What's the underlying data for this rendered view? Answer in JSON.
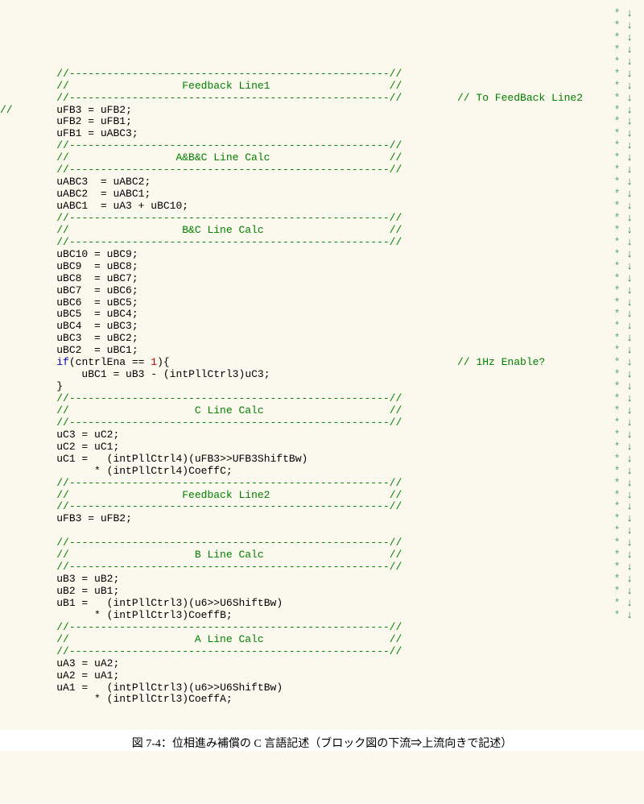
{
  "margin_marker": "* ↓",
  "keywords": {
    "if": "if"
  },
  "numbers": {
    "one": "1"
  },
  "vars": {
    "uFB3": "uFB3",
    "uFB2": "uFB2",
    "uFB1": "uFB1",
    "uABC3": "uABC3",
    "uABC2": "uABC2",
    "uABC1": "uABC1",
    "uA3": "uA3",
    "uA2": "uA2",
    "uA1": "uA1",
    "uB3": "uB3",
    "uB2": "uB2",
    "uB1": "uB1",
    "uC3": "uC3",
    "uC2": "uC2",
    "uC1": "uC1",
    "uBC10": "uBC10",
    "uBC9": "uBC9",
    "uBC8": "uBC8",
    "uBC7": "uBC7",
    "uBC6": "uBC6",
    "uBC5": "uBC5",
    "uBC4": "uBC4",
    "uBC3": "uBC3",
    "uBC2": "uBC2",
    "uBC1": "uBC1",
    "cntrlEna": "cntrlEna",
    "intPllCtrl3": "intPllCtrl3",
    "intPllCtrl4": "intPllCtrl4",
    "UFB3ShiftBw": "UFB3ShiftBw",
    "U6ShiftBw": "U6ShiftBw",
    "CoeffC": "CoeffC",
    "CoeffB": "CoeffB",
    "CoeffA": "CoeffA",
    "u6": "u6"
  },
  "side_comments": {
    "left_dblslash": "//",
    "to_fb_line2": "// To FeedBack Line2",
    "one_hz": "// 1Hz Enable?"
  },
  "sections": {
    "feedback1": "Feedback Line1",
    "abc": "A&B&C Line Calc",
    "bc": "B&C Line Calc",
    "c": "C Line Calc",
    "feedback2": "Feedback Line2",
    "b": "B Line Calc",
    "a": "A Line Calc"
  },
  "caption": "図 7-4：位相進み補償の C 言語記述（ブロック図の下流⇒上流向きで記述）"
}
